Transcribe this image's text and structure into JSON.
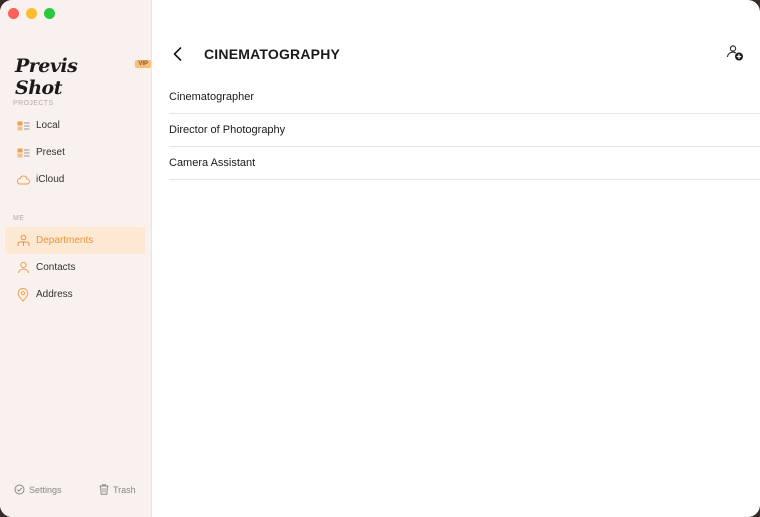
{
  "app": {
    "name": "Previs Shot",
    "badge": "VIP"
  },
  "sidebar": {
    "projects_label": "PROJECTS",
    "projects": [
      {
        "label": "Local",
        "icon": "local-icon"
      },
      {
        "label": "Preset",
        "icon": "preset-icon"
      },
      {
        "label": "iCloud",
        "icon": "cloud-icon"
      }
    ],
    "me_label": "ME",
    "me": [
      {
        "label": "Departments",
        "icon": "departments-icon",
        "active": true
      },
      {
        "label": "Contacts",
        "icon": "contacts-icon"
      },
      {
        "label": "Address",
        "icon": "location-pin-icon"
      }
    ],
    "footer": {
      "settings": "Settings",
      "trash": "Trash"
    }
  },
  "main": {
    "title": "CINEMATOGRAPHY",
    "roles": [
      "Cinematographer",
      "Director of Photography",
      "Camera Assistant"
    ]
  },
  "colors": {
    "accent": "#e8953b",
    "active_bg": "#fde8d3",
    "sidebar_bg": "#f8f1ee"
  }
}
